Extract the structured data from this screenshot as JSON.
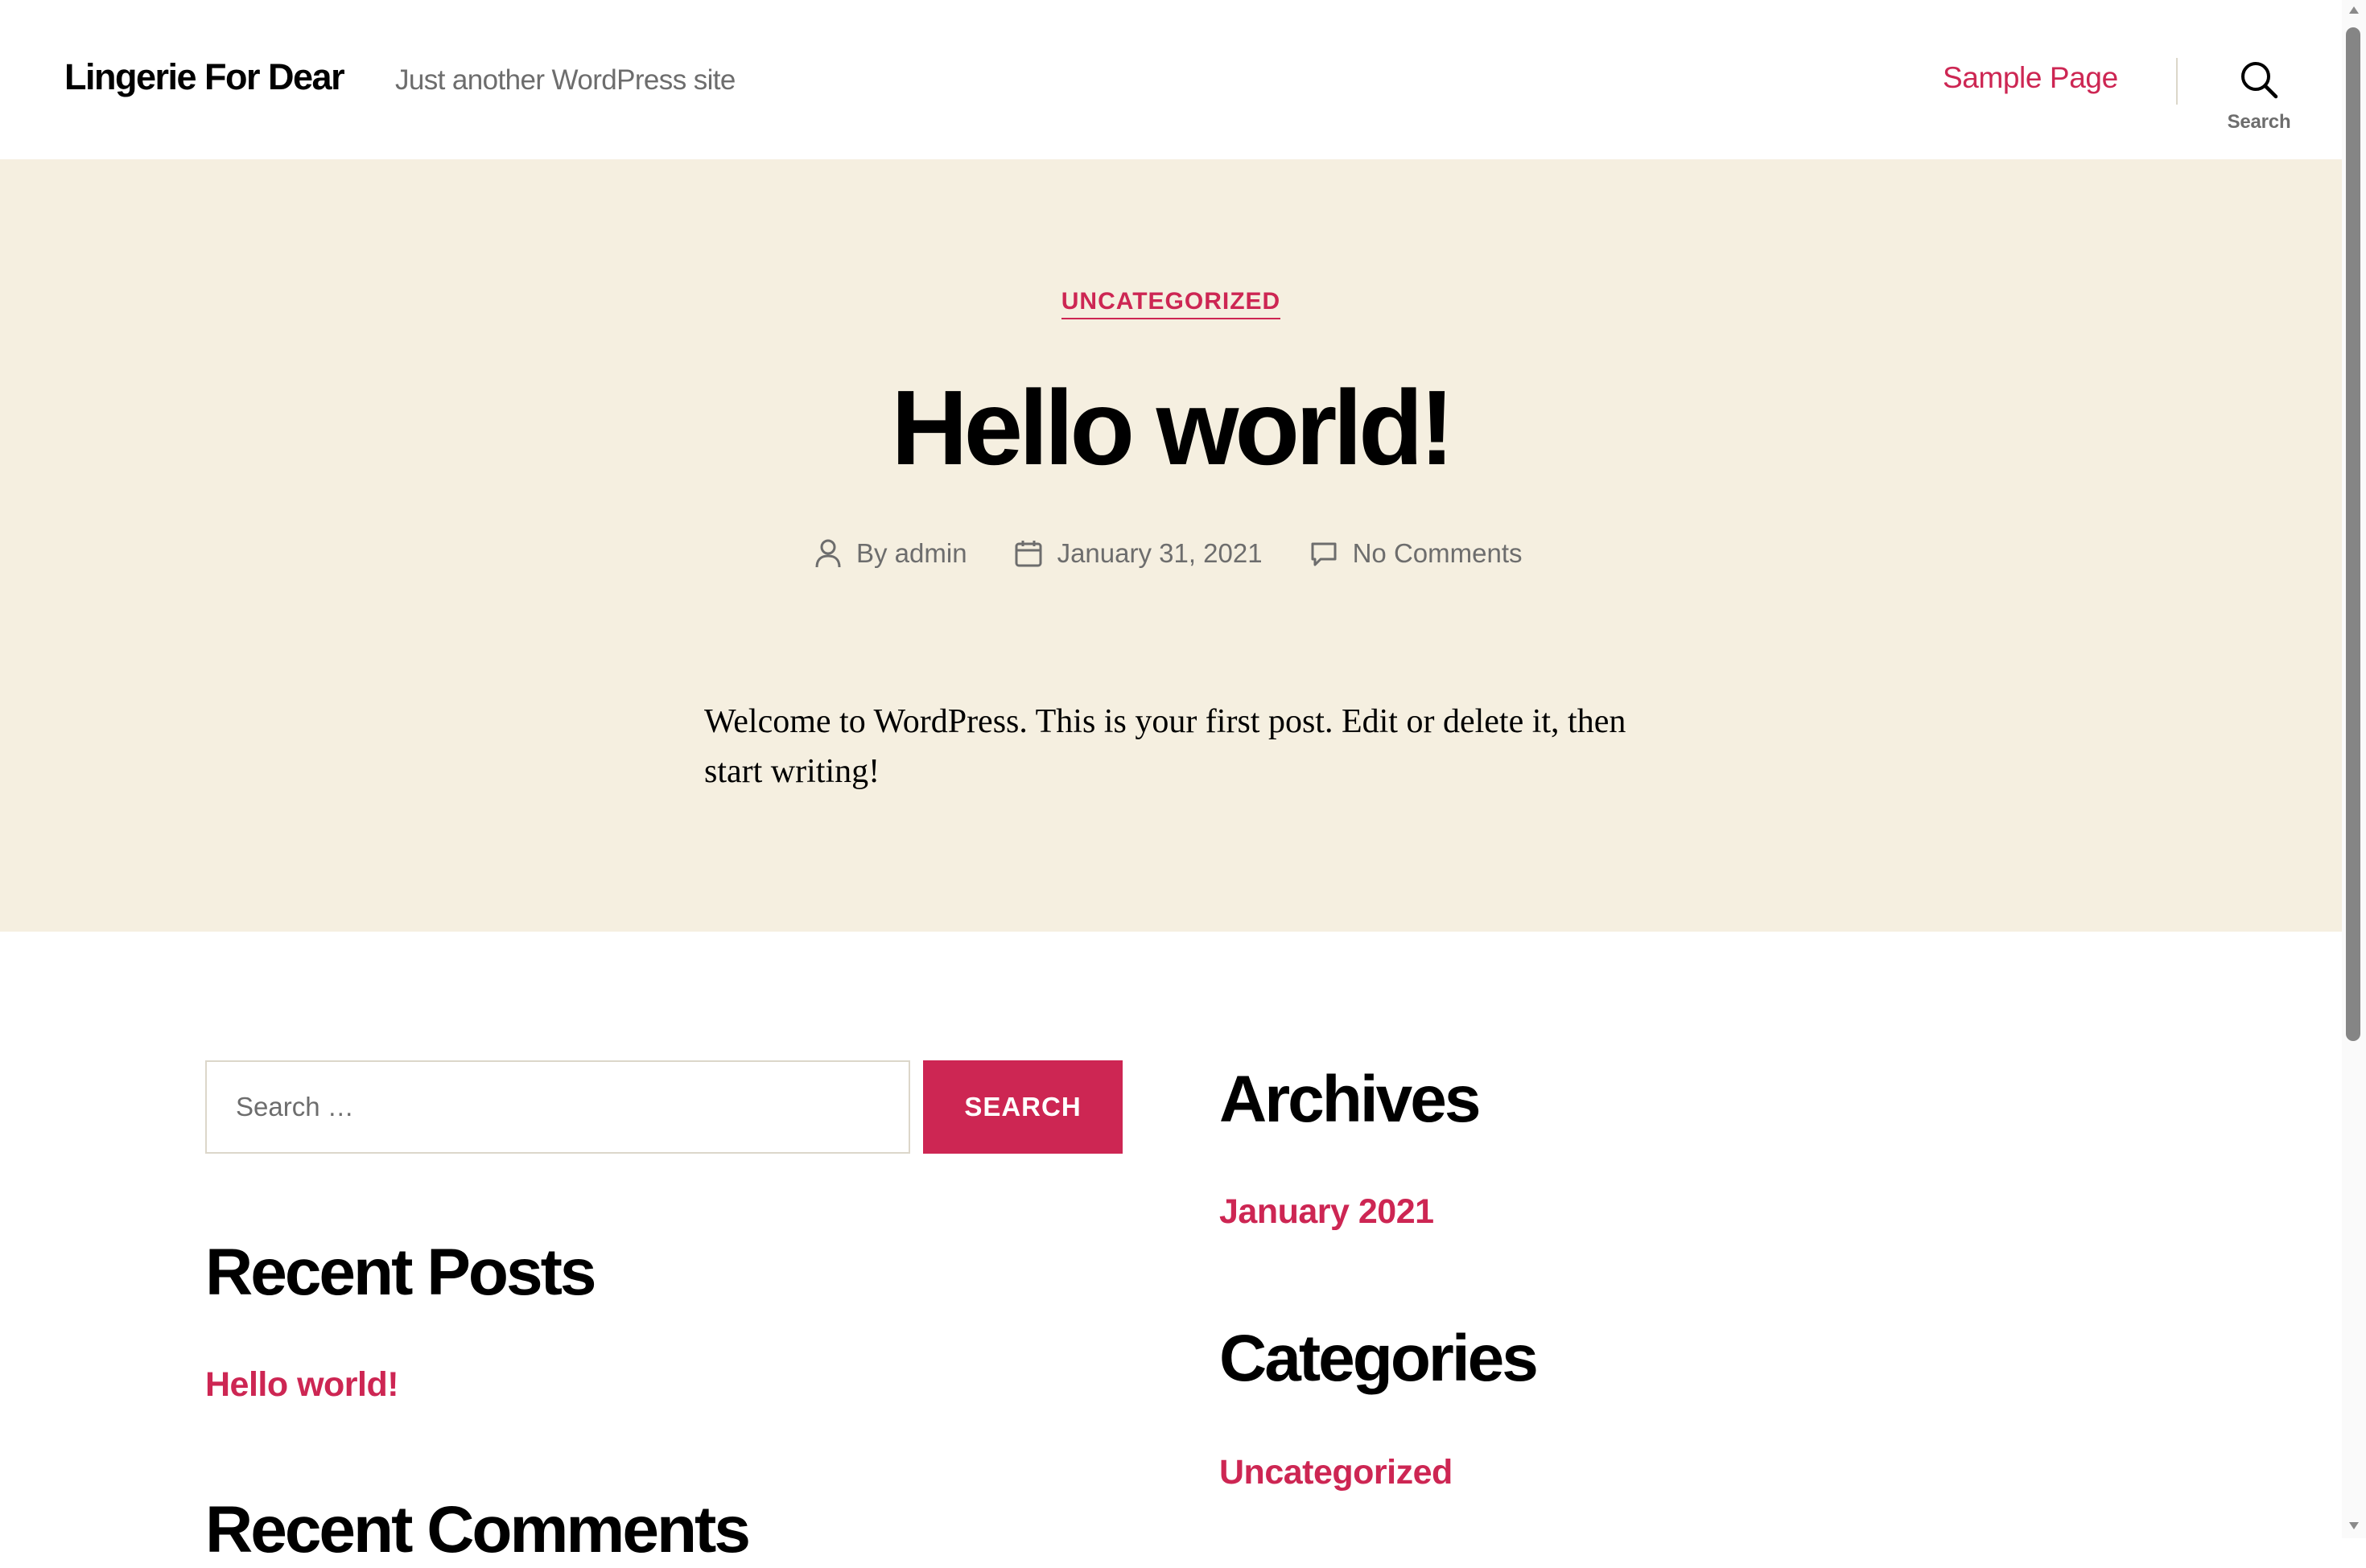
{
  "header": {
    "site_title": "Lingerie For Dear",
    "site_description": "Just another WordPress site",
    "nav": [
      {
        "label": "Sample Page"
      }
    ],
    "search_toggle_label": "Search"
  },
  "hero": {
    "category": "UNCATEGORIZED",
    "title": "Hello world!",
    "meta": {
      "author": "By admin",
      "date": "January 31, 2021",
      "comments": "No Comments"
    },
    "content": "Welcome to WordPress. This is your first post. Edit or delete it, then start writing!"
  },
  "widgets": {
    "search": {
      "placeholder": "Search …",
      "button_label": "SEARCH"
    },
    "recent_posts": {
      "title": "Recent Posts",
      "items": [
        "Hello world!"
      ]
    },
    "recent_comments": {
      "title": "Recent Comments"
    },
    "archives": {
      "title": "Archives",
      "items": [
        "January 2021"
      ]
    },
    "categories": {
      "title": "Categories",
      "items": [
        "Uncategorized"
      ]
    }
  },
  "colors": {
    "accent": "#cd2653",
    "hero_background": "#f5efe0",
    "secondary_text": "#6d6d6d"
  },
  "icons": [
    "search-icon",
    "user-icon",
    "calendar-icon",
    "comment-icon"
  ]
}
